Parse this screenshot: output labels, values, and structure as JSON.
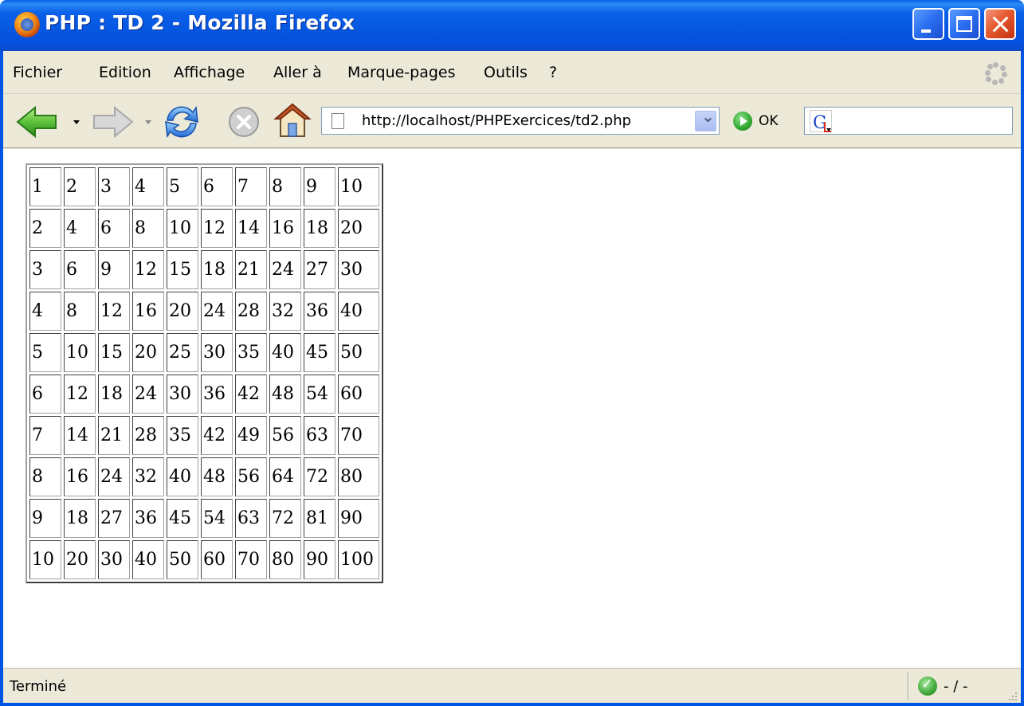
{
  "window": {
    "title": "PHP : TD 2 - Mozilla Firefox"
  },
  "menu": {
    "items": [
      {
        "label": "Fichier"
      },
      {
        "label": "Edition"
      },
      {
        "label": "Affichage"
      },
      {
        "label": "Aller à"
      },
      {
        "label": "Marque-pages"
      },
      {
        "label": "Outils"
      },
      {
        "label": "?"
      }
    ]
  },
  "navbar": {
    "icons": [
      "back-arrow-icon",
      "forward-arrow-icon",
      "reload-icon",
      "stop-icon",
      "home-icon"
    ],
    "url": "http://localhost/PHPExercices/td2.php",
    "go_label": "OK",
    "search_value": ""
  },
  "table": {
    "rows": [
      [
        "1",
        "2",
        "3",
        "4",
        "5",
        "6",
        "7",
        "8",
        "9",
        "10"
      ],
      [
        "2",
        "4",
        "6",
        "8",
        "10",
        "12",
        "14",
        "16",
        "18",
        "20"
      ],
      [
        "3",
        "6",
        "9",
        "12",
        "15",
        "18",
        "21",
        "24",
        "27",
        "30"
      ],
      [
        "4",
        "8",
        "12",
        "16",
        "20",
        "24",
        "28",
        "32",
        "36",
        "40"
      ],
      [
        "5",
        "10",
        "15",
        "20",
        "25",
        "30",
        "35",
        "40",
        "45",
        "50"
      ],
      [
        "6",
        "12",
        "18",
        "24",
        "30",
        "36",
        "42",
        "48",
        "54",
        "60"
      ],
      [
        "7",
        "14",
        "21",
        "28",
        "35",
        "42",
        "49",
        "56",
        "63",
        "70"
      ],
      [
        "8",
        "16",
        "24",
        "32",
        "40",
        "48",
        "56",
        "64",
        "72",
        "80"
      ],
      [
        "9",
        "18",
        "27",
        "36",
        "45",
        "54",
        "63",
        "72",
        "81",
        "90"
      ],
      [
        "10",
        "20",
        "30",
        "40",
        "50",
        "60",
        "70",
        "80",
        "90",
        "100"
      ]
    ]
  },
  "status": {
    "text": "Terminé",
    "security": "- / -"
  },
  "colors": {
    "titlebar": "#0556e0",
    "chrome": "#ece9d8",
    "close_button": "#e55a2f"
  }
}
